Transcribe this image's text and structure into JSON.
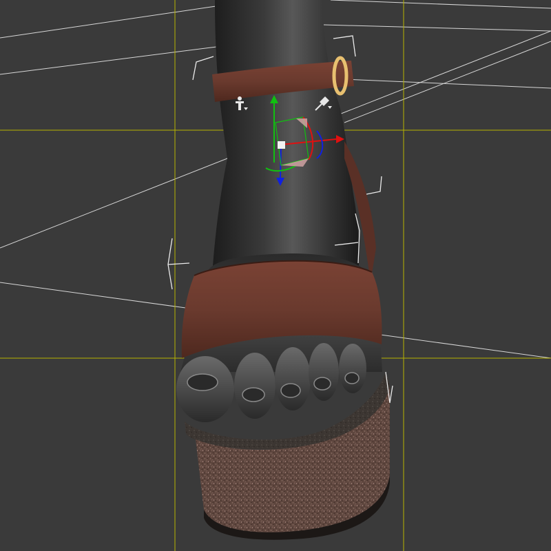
{
  "app": {
    "view_label": ""
  },
  "scene": {
    "background_color": "#3a3a3a",
    "guide_color": "#b8b400",
    "grid_line_color": "#d6d6d6",
    "bracket_color": "#e8e8e8",
    "skin_color": "#3c3c3c",
    "strap_color": "#6e3a2e",
    "buckle_color": "#e8c070",
    "cork_color": "#6a5048",
    "axis_x_color": "#e01010",
    "axis_y_color": "#10c010",
    "axis_z_color": "#1020e0"
  },
  "tools": {
    "figure_tool_icon": "figure-pose-icon",
    "pin_tool_icon": "pin-icon"
  }
}
